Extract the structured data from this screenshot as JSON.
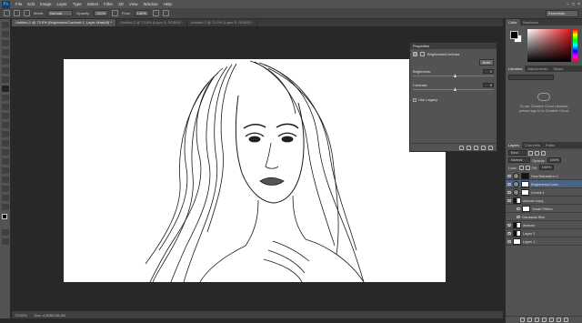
{
  "app": {
    "logo": "Ps"
  },
  "menu": [
    "File",
    "Edit",
    "Image",
    "Layer",
    "Type",
    "Select",
    "Filter",
    "3D",
    "View",
    "Window",
    "Help"
  ],
  "window_controls": [
    "–",
    "□",
    "×"
  ],
  "options_bar": {
    "mode_label": "Mode:",
    "mode_value": "Normal",
    "opacity_label": "Opacity:",
    "opacity_value": "100%",
    "flow_label": "Flow:",
    "flow_value": "100%"
  },
  "workspace": "Essentials",
  "doc_tabs": [
    "Untitled-1 @ 73.5% (Brightness/Contrast 1, Layer Mask/8) *",
    "Untitled-2 @ 73.5% (Layer 5, RGB/8) *",
    "Untitled-3 @ 73.5% (Layer 5, RGB/8) *"
  ],
  "status": {
    "zoom": "73.53%",
    "doc": "Doc: 4,505K/28.0M"
  },
  "properties": {
    "title": "Properties",
    "layer_type": "Brightness/Contrast",
    "auto": "Auto",
    "brightness_label": "Brightness:",
    "brightness_value": "0",
    "contrast_label": "Contrast:",
    "contrast_value": "0",
    "legacy_label": "Use Legacy"
  },
  "color_panel": {
    "tabs": [
      "Color",
      "Swatches"
    ]
  },
  "libraries_panel": {
    "tabs": [
      "Libraries",
      "Adjustments",
      "Styles"
    ],
    "select": "",
    "message_line1": "To use Creative Cloud Libraries,",
    "message_line2": "please sign in to Creative Cloud."
  },
  "layers_panel": {
    "tabs": [
      "Layers",
      "Channels",
      "Paths"
    ],
    "kind": "Kind",
    "blend": "Normal",
    "opacity_label": "Opacity:",
    "opacity_value": "100%",
    "lock_label": "Lock:",
    "fill_label": "Fill:",
    "fill_value": "100%",
    "layers": [
      {
        "name": "Hue/Saturation 1",
        "thumb": "adj"
      },
      {
        "name": "Brightness/Contr...",
        "thumb": "adj",
        "selected": true
      },
      {
        "name": "Levels 1",
        "thumb": "adj"
      },
      {
        "name": "woman copy",
        "thumb": "dark"
      },
      {
        "name": "Smart Filters",
        "thumb": "box",
        "indent": true
      },
      {
        "name": "Gaussian Blur",
        "thumb": "none",
        "indent": true
      },
      {
        "name": "woman",
        "thumb": "dark"
      },
      {
        "name": "Layer 2",
        "thumb": "dark"
      },
      {
        "name": "Layer 1",
        "thumb": "box"
      }
    ]
  },
  "colors": {
    "foreground": "#000000",
    "background": "#ffffff",
    "selected_layer": "#4b6383"
  }
}
